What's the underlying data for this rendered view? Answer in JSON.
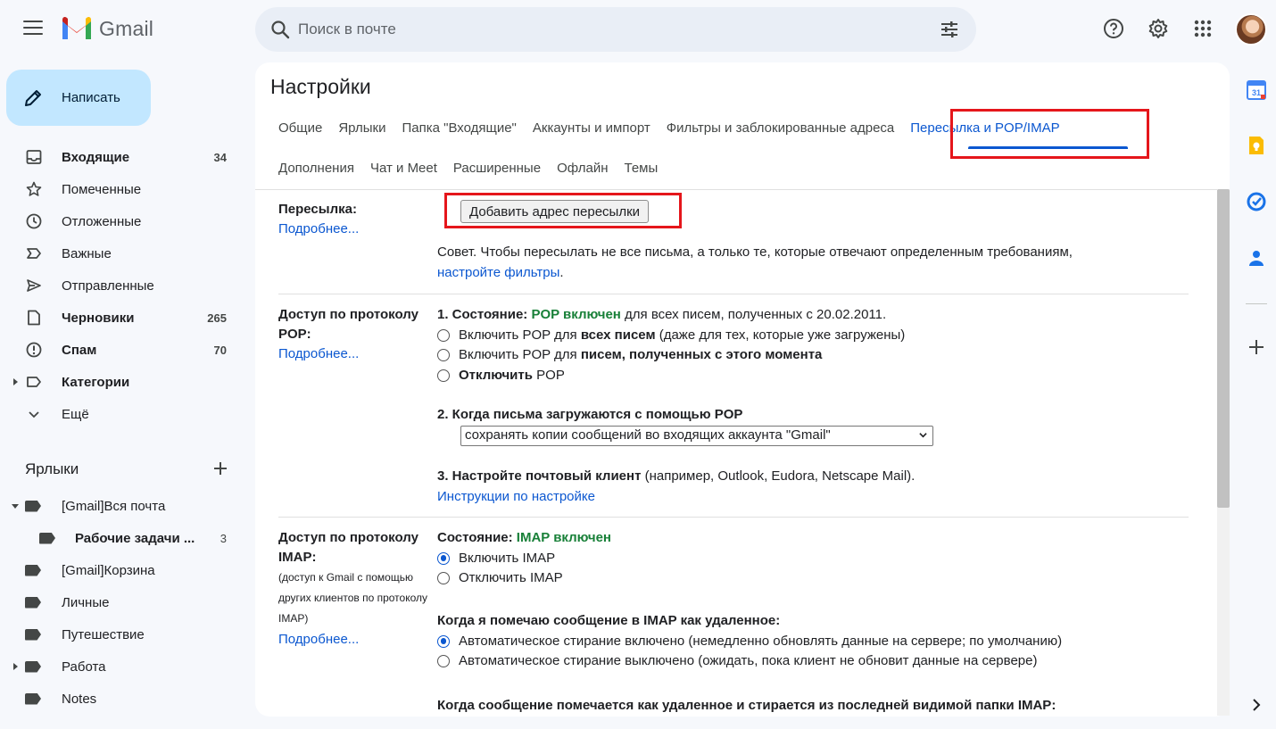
{
  "app": {
    "name": "Gmail"
  },
  "search": {
    "placeholder": "Поиск в почте"
  },
  "compose": {
    "label": "Написать"
  },
  "nav": [
    {
      "label": "Входящие",
      "count": "34",
      "bold": true,
      "icon": "inbox-icon"
    },
    {
      "label": "Помеченные",
      "count": "",
      "bold": false,
      "icon": "star-icon"
    },
    {
      "label": "Отложенные",
      "count": "",
      "bold": false,
      "icon": "clock-icon"
    },
    {
      "label": "Важные",
      "count": "",
      "bold": false,
      "icon": "important-icon"
    },
    {
      "label": "Отправленные",
      "count": "",
      "bold": false,
      "icon": "send-icon"
    },
    {
      "label": "Черновики",
      "count": "265",
      "bold": true,
      "icon": "draft-icon"
    },
    {
      "label": "Спам",
      "count": "70",
      "bold": true,
      "icon": "spam-icon"
    },
    {
      "label": "Категории",
      "count": "",
      "bold": true,
      "icon": "label-outline-icon"
    },
    {
      "label": "Ещё",
      "count": "",
      "bold": false,
      "icon": "chevron-down-icon"
    }
  ],
  "labels_section": {
    "title": "Ярлыки",
    "items": [
      {
        "label": "[Gmail]Вся почта",
        "count": ""
      },
      {
        "label": "Рабочие задачи ...",
        "count": "3"
      },
      {
        "label": "[Gmail]Корзина",
        "count": ""
      },
      {
        "label": "Личные",
        "count": ""
      },
      {
        "label": "Путешествие",
        "count": ""
      },
      {
        "label": "Работа",
        "count": ""
      },
      {
        "label": "Notes",
        "count": ""
      }
    ]
  },
  "settings": {
    "title": "Настройки",
    "tabs_row1": [
      "Общие",
      "Ярлыки",
      "Папка \"Входящие\"",
      "Аккаунты и импорт",
      "Фильтры и заблокированные адреса",
      "Пересылка и POP/IMAP"
    ],
    "tabs_row2": [
      "Дополнения",
      "Чат и Meet",
      "Расширенные",
      "Офлайн",
      "Темы"
    ],
    "active_tab": "Пересылка и POP/IMAP",
    "forwarding": {
      "label": "Пересылка:",
      "more": "Подробнее...",
      "button": "Добавить адрес пересылки",
      "tip": "Совет. Чтобы пересылать не все письма, а только те, которые отвечают определенным требованиям,",
      "tip_link": "настройте фильтры",
      "tip_end": "."
    },
    "pop": {
      "label": "Доступ по протоколу POP:",
      "more": "Подробнее...",
      "status_prefix": "1. Состояние:",
      "status_value": "POP включен",
      "status_suffix": "для всех писем, полученных с 20.02.2011.",
      "opt1_a": "Включить POP для",
      "opt1_b": "всех писем",
      "opt1_c": "(даже для тех, которые уже загружены)",
      "opt2_a": "Включить POP для",
      "opt2_b": "писем, полученных с этого момента",
      "opt3_a": "Отключить",
      "opt3_b": "POP",
      "when_title": "2. Когда письма загружаются с помощью POP",
      "when_select": "сохранять копии сообщений во входящих аккаунта \"Gmail\"",
      "client_title": "3. Настройте почтовый клиент",
      "client_suffix": "(например, Outlook, Eudora, Netscape Mail).",
      "client_link": "Инструкции по настройке"
    },
    "imap": {
      "label": "Доступ по протоколу IMAP:",
      "note": "(доступ к Gmail с помощью других клиентов по протоколу IMAP)",
      "more": "Подробнее...",
      "status_prefix": "Состояние:",
      "status_value": "IMAP включен",
      "opt_enable": "Включить IMAP",
      "opt_disable": "Отключить IMAP",
      "delete_title": "Когда я помечаю сообщение в IMAP как удаленное:",
      "auto_on": "Автоматическое стирание включено (немедленно обновлять данные на сервере; по умолчанию)",
      "auto_off": "Автоматическое стирание выключено (ожидать, пока клиент не обновит данные на сервере)",
      "expunge_title": "Когда сообщение помечается как удаленное и стирается из последней видимой папки IMAP:"
    }
  },
  "side_panel": [
    "calendar-icon",
    "keep-icon",
    "tasks-icon",
    "contacts-icon",
    "add-icon"
  ],
  "colors": {
    "accent": "#0b57d0",
    "compose_bg": "#c2e7ff",
    "highlight_box": "#e5161b",
    "enabled_green": "#188038"
  }
}
